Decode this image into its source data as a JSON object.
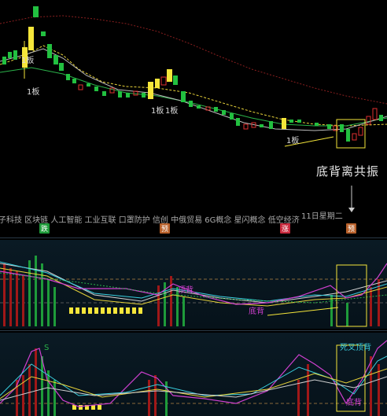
{
  "main": {
    "board_labels": [
      "1板",
      "1板",
      "1板",
      "1板",
      "1板"
    ],
    "tags_row": "子科技 区块链 人工智能 工业互联 口罩防护 信创 中俄贸易 6G概念 星闪概念 低空经济",
    "date_label": "11日星期二",
    "annotation": "底背离共振",
    "badges": [
      {
        "text": "跌",
        "color": "#1e9b3a"
      },
      {
        "text": "预",
        "color": "#b8602a"
      },
      {
        "text": "涨",
        "color": "#c8283c"
      },
      {
        "text": "预",
        "color": "#b8602a"
      }
    ]
  },
  "indicator1": {
    "label_a": "顶背",
    "label_b": "底背"
  },
  "indicator2": {
    "label_s": "S",
    "label_top": "死叉顶背",
    "label_bottom": "底背"
  },
  "colors": {
    "up": "#e03030",
    "down": "#22c040",
    "yellow": "#f5e63a",
    "bg": "#000000"
  }
}
